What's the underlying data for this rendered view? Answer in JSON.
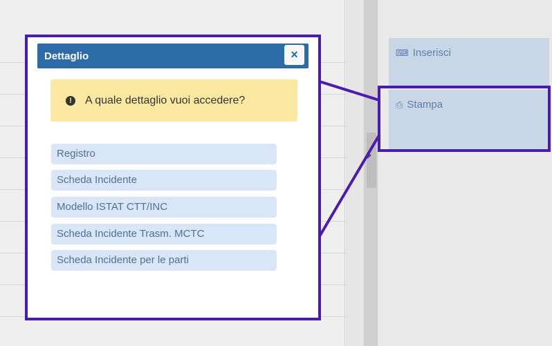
{
  "dialog": {
    "title": "Dettaglio",
    "close_symbol": "×",
    "alert_text": "A quale dettaglio vuoi accedere?",
    "options": [
      "Registro",
      "Scheda Incidente",
      "Modello ISTAT CTT/INC",
      "Scheda Incidente Trasm. MCTC",
      "Scheda Incidente per le parti"
    ]
  },
  "actions": {
    "insert": {
      "label": "Inserisci",
      "icon": "keyboard-icon"
    },
    "print": {
      "label": "Stampa",
      "icon": "printer-icon"
    }
  },
  "colors": {
    "highlight": "#4a1cae",
    "dialog_header": "#2d6aa8",
    "alert_bg": "#fbe9a2",
    "option_bg": "#d9e6f7",
    "tile_bg": "#c9d6e6"
  }
}
